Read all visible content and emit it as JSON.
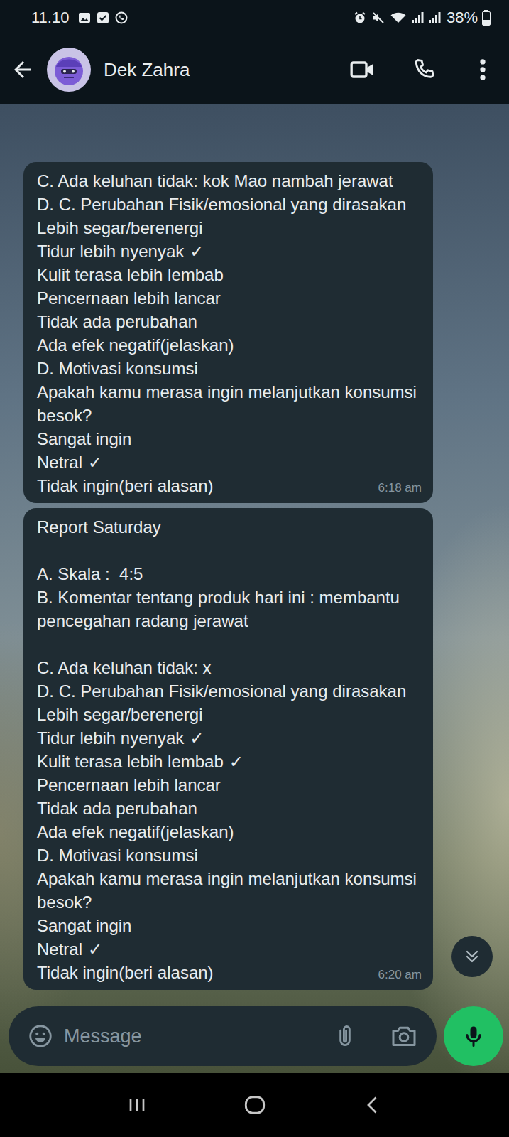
{
  "status_bar": {
    "time": "11.10",
    "battery": "38%",
    "battery_level": 0.38
  },
  "header": {
    "contact": "Dek Zahra"
  },
  "check_mark": "✓",
  "messages": [
    {
      "time": "6:18 am",
      "lines": [
        {
          "text": "C. Ada keluhan tidak: kok Mao nambah jerawat",
          "checked": false
        },
        {
          "text": "D. C. Perubahan Fisik/emosional yang dirasakan",
          "checked": false
        },
        {
          "text": "Lebih segar/berenergi",
          "checked": false
        },
        {
          "text": "Tidur lebih nyenyak",
          "checked": true
        },
        {
          "text": "Kulit terasa lebih lembab",
          "checked": false
        },
        {
          "text": "Pencernaan lebih lancar",
          "checked": false
        },
        {
          "text": "Tidak ada perubahan",
          "checked": false
        },
        {
          "text": "Ada efek negatif(jelaskan)",
          "checked": false
        },
        {
          "text": "D. Motivasi konsumsi",
          "checked": false
        },
        {
          "text": "Apakah kamu merasa ingin melanjutkan konsumsi besok?",
          "checked": false
        },
        {
          "text": "Sangat ingin",
          "checked": false
        },
        {
          "text": "Netral",
          "checked": true
        },
        {
          "text": "Tidak ingin(beri alasan)",
          "checked": false
        }
      ]
    },
    {
      "time": "6:20 am",
      "lines": [
        {
          "text": "Report Saturday",
          "checked": false
        },
        {
          "text": "",
          "checked": false
        },
        {
          "text": "A. Skala :  4:5",
          "checked": false
        },
        {
          "text": "B. Komentar tentang produk hari ini : membantu pencegahan radang jerawat",
          "checked": false
        },
        {
          "text": "",
          "checked": false
        },
        {
          "text": "C. Ada keluhan tidak: x",
          "checked": false
        },
        {
          "text": "D. C. Perubahan Fisik/emosional yang dirasakan",
          "checked": false
        },
        {
          "text": "Lebih segar/berenergi",
          "checked": false
        },
        {
          "text": "Tidur lebih nyenyak",
          "checked": true
        },
        {
          "text": "Kulit terasa lebih lembab",
          "checked": true
        },
        {
          "text": "Pencernaan lebih lancar",
          "checked": false
        },
        {
          "text": "Tidak ada perubahan",
          "checked": false
        },
        {
          "text": "Ada efek negatif(jelaskan)",
          "checked": false
        },
        {
          "text": "D. Motivasi konsumsi",
          "checked": false
        },
        {
          "text": "Apakah kamu merasa ingin melanjutkan konsumsi besok?",
          "checked": false
        },
        {
          "text": "Sangat ingin",
          "checked": false
        },
        {
          "text": "Netral",
          "checked": true
        },
        {
          "text": "Tidak ingin(beri alasan)",
          "checked": false
        }
      ]
    }
  ],
  "composer": {
    "placeholder": "Message"
  }
}
